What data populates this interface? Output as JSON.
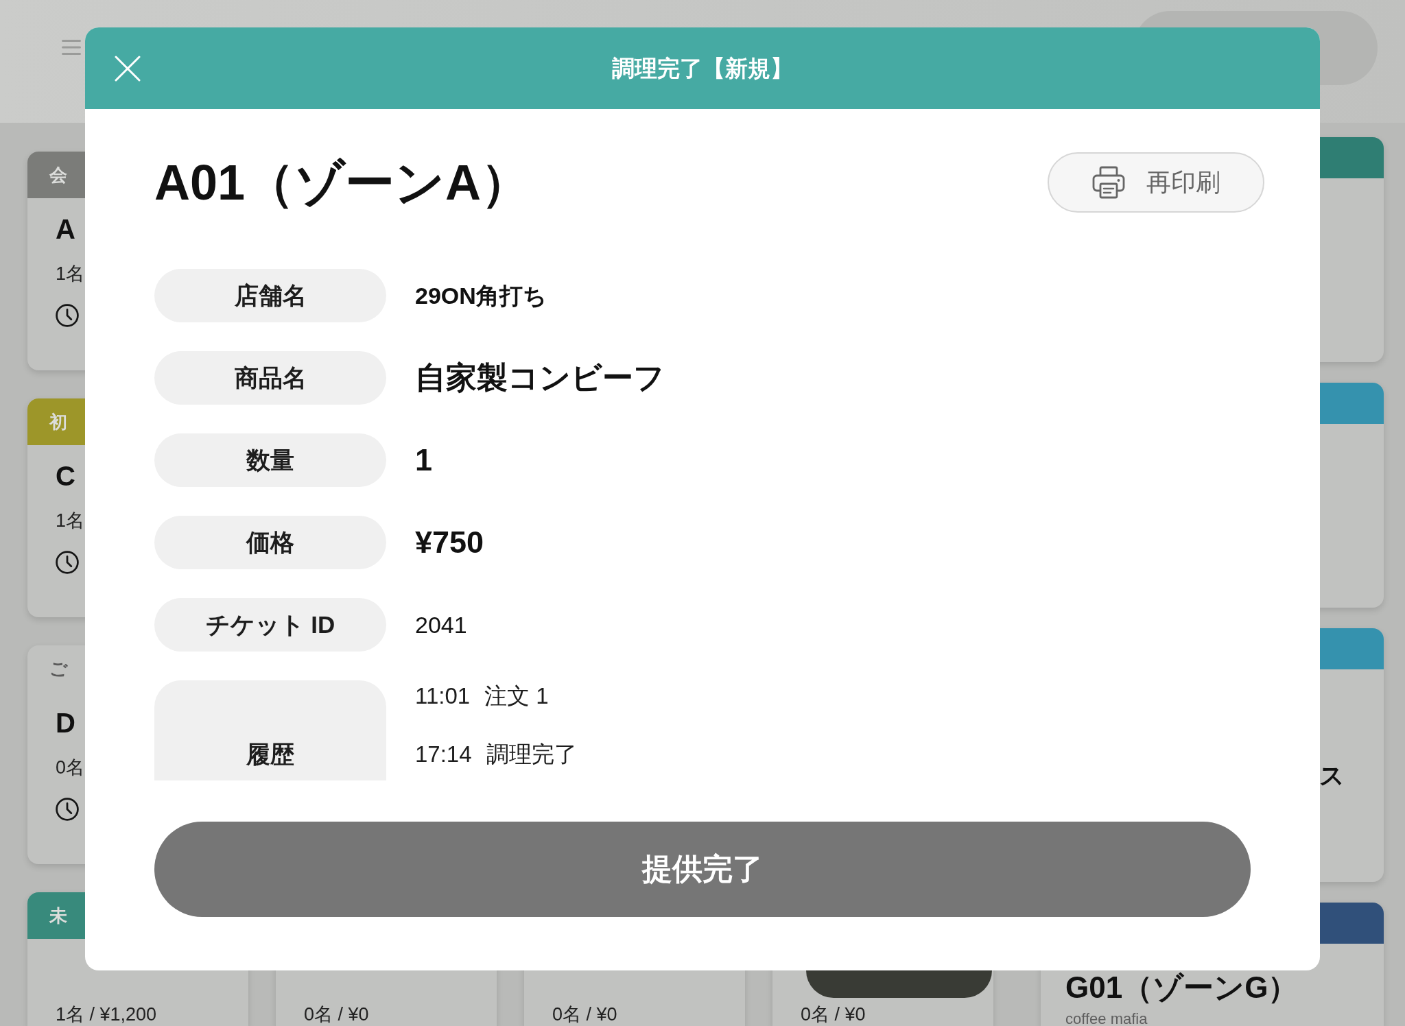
{
  "board": {
    "grid_rows": [
      {
        "cards": [
          {
            "status": {
              "label": "会",
              "color": "#7b7c79"
            },
            "name": "A",
            "guests": "1名",
            "timer": true
          }
        ]
      },
      {
        "cards": [
          {
            "status": {
              "label": "初",
              "color": "#9d9629"
            },
            "name": "C",
            "guests": "1名",
            "timer": true
          }
        ]
      },
      {
        "cards": [
          {
            "status": {
              "label": "ご"
            },
            "name": "D",
            "guests": "0名",
            "timer": true
          }
        ]
      },
      {
        "cards": [
          {
            "status": {
              "label": "未",
              "color": "#388a7c"
            },
            "guests": "1名 / ¥1,200"
          },
          {
            "guests": "0名 / ¥0"
          },
          {
            "guests": "0名 / ¥0"
          },
          {
            "guests": "0名 / ¥0"
          }
        ]
      }
    ],
    "side_cards": [
      {
        "color": "#2f7e73"
      },
      {
        "color": "#3592ae"
      },
      {
        "color": "#3592ae",
        "note": "ス"
      },
      {
        "color": "#30507a",
        "title": "G01（ゾーンG）",
        "subtitle": "coffee mafia"
      }
    ]
  },
  "dialog": {
    "title": "調理完了【新規】",
    "heading": "A01（ゾーンA）",
    "reprint_button": "再印刷",
    "fields": [
      {
        "label": "店舗名",
        "value": "29ON角打ち",
        "kind": "bold"
      },
      {
        "label": "商品名",
        "value": "自家製コンビーフ",
        "kind": "large"
      },
      {
        "label": "数量",
        "value": "1",
        "kind": "large"
      },
      {
        "label": "価格",
        "value": "¥750",
        "kind": "large"
      },
      {
        "label": "チケット ID",
        "value": "2041",
        "kind": "plain"
      }
    ],
    "history": {
      "label": "履歴",
      "entries": [
        {
          "time": "11:01",
          "event": "注文 1"
        },
        {
          "time": "17:14",
          "event": "調理完了"
        }
      ]
    },
    "submit_button": "提供完了"
  }
}
